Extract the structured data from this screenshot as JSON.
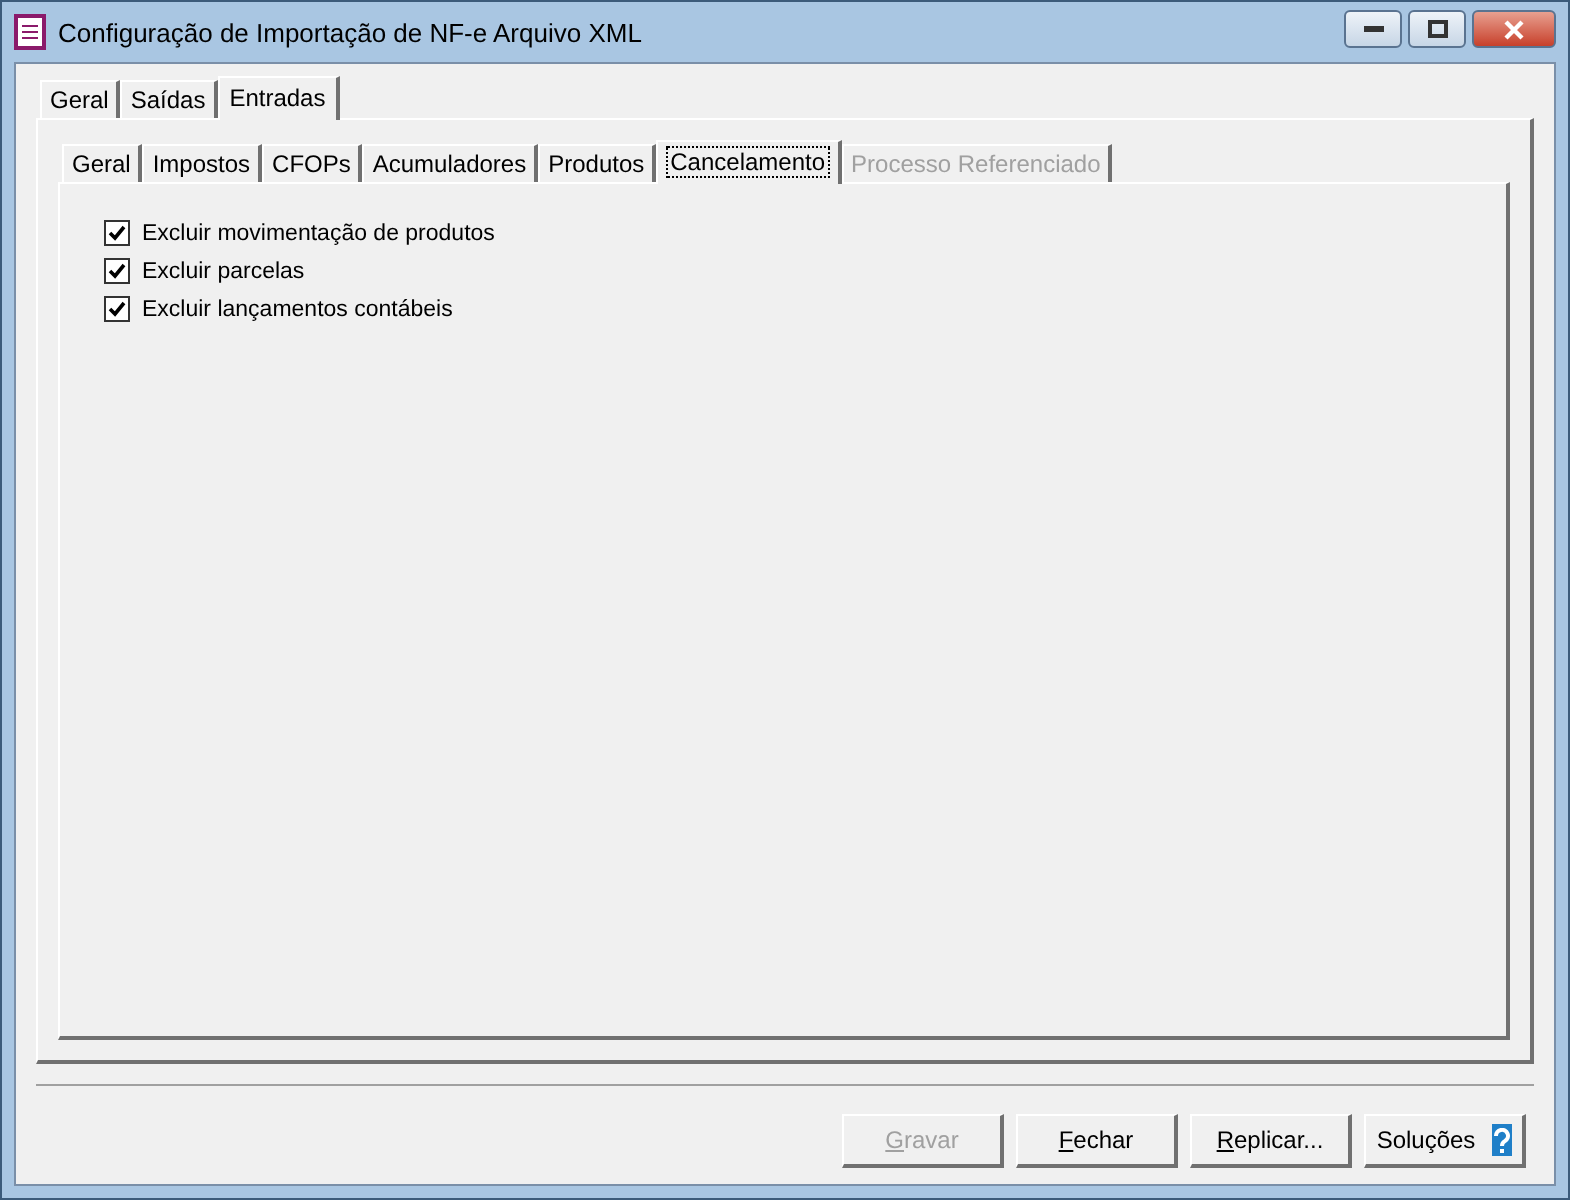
{
  "window": {
    "title": "Configuração de Importação de NF-e Arquivo XML"
  },
  "outer_tabs": [
    {
      "label": "Geral",
      "selected": false
    },
    {
      "label": "Saídas",
      "selected": false
    },
    {
      "label": "Entradas",
      "selected": true
    }
  ],
  "inner_tabs": [
    {
      "label": "Geral",
      "selected": false,
      "disabled": false
    },
    {
      "label": "Impostos",
      "selected": false,
      "disabled": false
    },
    {
      "label": "CFOPs",
      "selected": false,
      "disabled": false
    },
    {
      "label": "Acumuladores",
      "selected": false,
      "disabled": false
    },
    {
      "label": "Produtos",
      "selected": false,
      "disabled": false
    },
    {
      "label": "Cancelamento",
      "selected": true,
      "disabled": false
    },
    {
      "label": "Processo Referenciado",
      "selected": false,
      "disabled": true
    }
  ],
  "options": [
    {
      "label": "Excluir movimentação de produtos",
      "checked": true
    },
    {
      "label": "Excluir parcelas",
      "checked": true
    },
    {
      "label": "Excluir lançamentos contábeis",
      "checked": true
    }
  ],
  "buttons": [
    {
      "label": "Gravar",
      "disabled": true,
      "mnemonic": true,
      "kind": "plain"
    },
    {
      "label": "Fechar",
      "disabled": false,
      "mnemonic": true,
      "kind": "plain"
    },
    {
      "label": "Replicar...",
      "disabled": false,
      "mnemonic": true,
      "kind": "plain"
    },
    {
      "label": "Soluções",
      "disabled": false,
      "mnemonic": false,
      "kind": "help"
    }
  ]
}
